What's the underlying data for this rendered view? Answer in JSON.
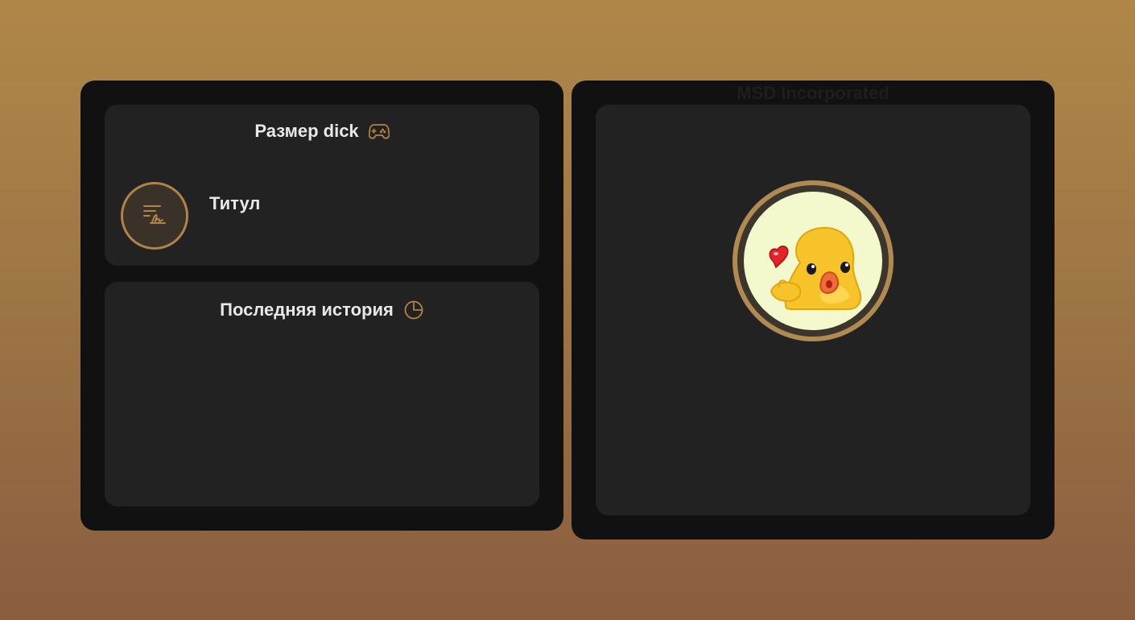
{
  "game_card": {
    "title": "Размер dick",
    "title_icon": "gamepad-icon",
    "badge_icon": "signature-list-icon",
    "label": "Титул"
  },
  "history_card": {
    "title": "Последняя история",
    "title_icon": "clock-pie-icon"
  },
  "profile": {
    "company": "MSD Incorporated",
    "avatar": "duck-sticker-with-heart"
  },
  "colors": {
    "accent": "#b0834a",
    "panel_bg": "#111111",
    "card_bg": "#222222",
    "text": "#e8e8e8"
  }
}
